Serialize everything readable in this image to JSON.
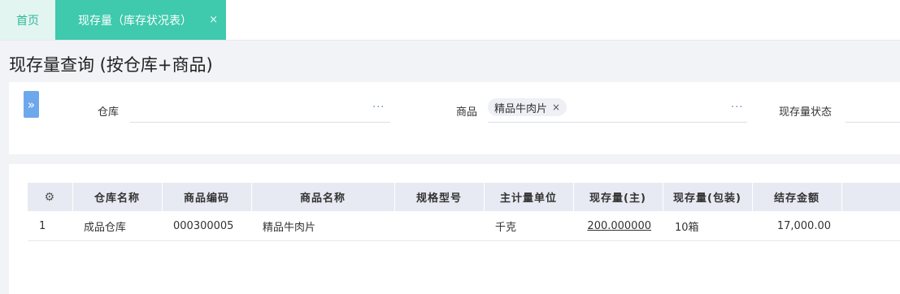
{
  "tabs": {
    "home_label": "首页",
    "active_label": "现存量（库存状况表）",
    "close_glyph": "×"
  },
  "page_title": "现存量查询 (按仓库+商品)",
  "filters": {
    "expand_glyph": "»",
    "warehouse_label": "仓库",
    "warehouse_more": "···",
    "product_label": "商品",
    "product_tag": "精品牛肉片",
    "product_tag_remove": "×",
    "product_more": "···",
    "stock_status_label": "现存量状态"
  },
  "table": {
    "settings_icon": "gear-icon",
    "headers": [
      "仓库名称",
      "商品编码",
      "商品名称",
      "规格型号",
      "主计量单位",
      "现存量(主)",
      "现存量(包装)",
      "结存金额"
    ],
    "rows": [
      {
        "index": "1",
        "warehouse": "成品仓库",
        "code": "000300005",
        "name": "精品牛肉片",
        "spec": "",
        "unit": "千克",
        "qty_main": "200.000000",
        "qty_pack": "10箱",
        "amount": "17,000.00"
      }
    ]
  },
  "colors": {
    "accent_teal": "#3fc9ad",
    "expand_blue": "#6ea8ec",
    "header_bg": "#e8eaf3"
  }
}
